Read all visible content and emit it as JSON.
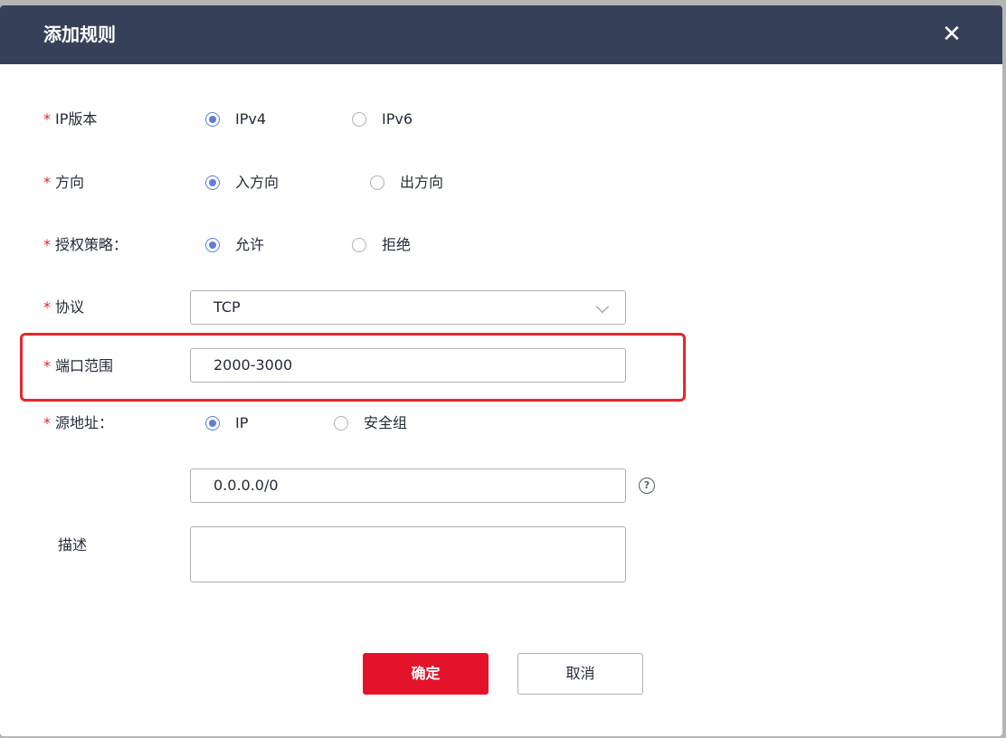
{
  "dialog": {
    "title": "添加规则",
    "close_icon": "close-icon",
    "close_glyph": "✕"
  },
  "form": {
    "required_mark": "*",
    "ip_version": {
      "label": "IP版本",
      "options": [
        "IPv4",
        "IPv6"
      ],
      "selected": "IPv4"
    },
    "direction": {
      "label": "方向",
      "options": [
        "入方向",
        "出方向"
      ],
      "selected": "入方向"
    },
    "policy": {
      "label": "授权策略：",
      "options": [
        "允许",
        "拒绝"
      ],
      "selected": "允许"
    },
    "protocol": {
      "label": "协议",
      "value": "TCP",
      "icon": "chevron-down-icon"
    },
    "port_range": {
      "label": "端口范围",
      "value": "2000-3000",
      "highlight_color": "#e8272c"
    },
    "source": {
      "label": "源地址：",
      "options": [
        "IP",
        "安全组"
      ],
      "selected": "IP",
      "value": "0.0.0.0/0",
      "help_icon": "question-circle-icon",
      "help_glyph": "?"
    },
    "description": {
      "label": "描述",
      "value": ""
    }
  },
  "buttons": {
    "confirm": "确定",
    "cancel": "取消"
  },
  "colors": {
    "header": "#364159",
    "accent": "#5e7ce0",
    "primary_button": "#e5132a",
    "required": "#e5232c"
  }
}
